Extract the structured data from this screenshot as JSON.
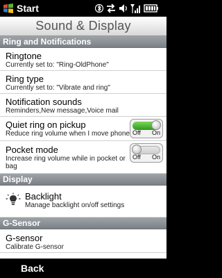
{
  "status": {
    "start_label": "Start",
    "icons": [
      "windows-flag-icon",
      "bluetooth-icon",
      "data-arrows-icon",
      "volume-icon",
      "signal-icon",
      "battery-icon"
    ]
  },
  "title": "Sound & Display",
  "sections": {
    "ring": "Ring and Notifications",
    "display": "Display",
    "gsensor": "G-Sensor"
  },
  "items": {
    "ringtone": {
      "label": "Ringtone",
      "sub": "Currently set to: \"Ring-OldPhone\""
    },
    "ringtype": {
      "label": "Ring type",
      "sub": "Currently set to: \"Vibrate and ring\""
    },
    "notif": {
      "label": "Notification sounds",
      "sub": "Reminders,New message,Voice mail"
    },
    "quiet": {
      "label": "Quiet ring on pickup",
      "sub": "Reduce ring volume when I move phone",
      "off": "Off",
      "on": "On",
      "state": "on"
    },
    "pocket": {
      "label": "Pocket mode",
      "sub": "Increase ring volume while in pocket or bag",
      "off": "Off",
      "on": "On",
      "state": "off"
    },
    "backlight": {
      "label": "Backlight",
      "sub": "Manage backlight on/off settings",
      "icon": "bulb-icon"
    },
    "gsensor": {
      "label": "G-sensor",
      "sub": "Calibrate G-sensor"
    }
  },
  "softkeys": {
    "left": "Back"
  },
  "colors": {
    "toggle_on": "#3fae2a",
    "section_bg": "#8a9095"
  }
}
